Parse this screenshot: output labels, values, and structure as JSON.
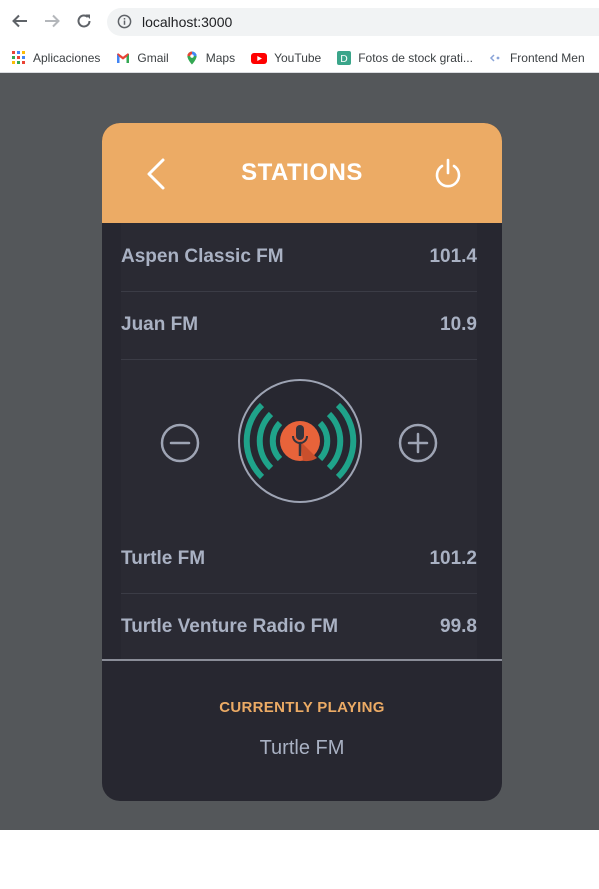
{
  "browser": {
    "url": "localhost:3000",
    "bookmarks": [
      {
        "label": "Aplicaciones",
        "icon": "apps-grid-icon"
      },
      {
        "label": "Gmail",
        "icon": "gmail-icon"
      },
      {
        "label": "Maps",
        "icon": "maps-icon"
      },
      {
        "label": "YouTube",
        "icon": "youtube-icon"
      },
      {
        "label": "Fotos de stock grati...",
        "icon": "stock-photos-icon"
      },
      {
        "label": "Frontend Men",
        "icon": "frontend-mentor-icon"
      }
    ]
  },
  "app": {
    "header_title": "STATIONS",
    "stations": [
      {
        "name": "Aspen Classic FM",
        "frequency": "101.4"
      },
      {
        "name": "Juan FM",
        "frequency": "10.9"
      },
      {
        "name": "Turtle FM",
        "frequency": "101.2"
      },
      {
        "name": "Turtle Venture Radio FM",
        "frequency": "99.8"
      }
    ],
    "currently_playing_label": "CURRENTLY PLAYING",
    "currently_playing_station": "Turtle FM",
    "colors": {
      "accent": "#ecab65",
      "card_background": "#272730",
      "page_background": "#54575a",
      "dial_green": "#1fa38a",
      "dial_orange": "#e8633a",
      "text": "#a9b1c3"
    }
  }
}
